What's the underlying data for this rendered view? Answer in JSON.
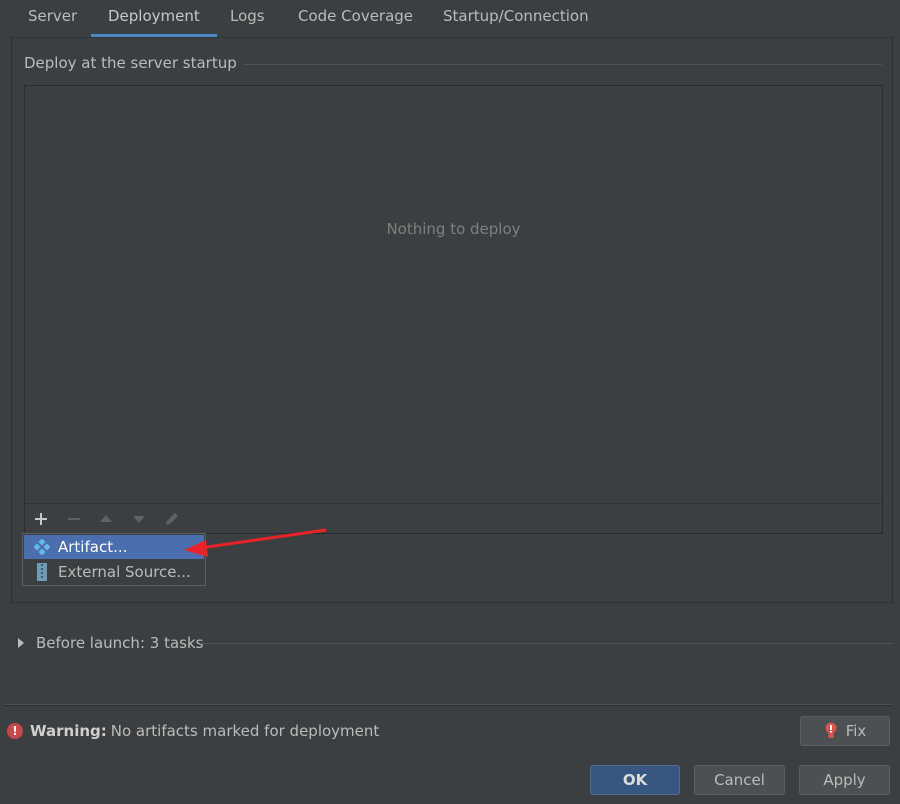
{
  "tabs": [
    {
      "label": "Server"
    },
    {
      "label": "Deployment"
    },
    {
      "label": "Logs"
    },
    {
      "label": "Code Coverage"
    },
    {
      "label": "Startup/Connection"
    }
  ],
  "active_tab": "Deployment",
  "deploy": {
    "section_title": "Deploy at the server startup",
    "empty_text": "Nothing to deploy",
    "toolbar": [
      {
        "icon": "plus-icon",
        "enabled": true
      },
      {
        "icon": "minus-icon",
        "enabled": false
      },
      {
        "icon": "arrow-up-icon",
        "enabled": false
      },
      {
        "icon": "arrow-down-icon",
        "enabled": false
      },
      {
        "icon": "pencil-icon",
        "enabled": false
      }
    ]
  },
  "popup": {
    "items": [
      {
        "label": "Artifact...",
        "icon": "artifact-icon",
        "selected": true
      },
      {
        "label": "External Source...",
        "icon": "archive-icon",
        "selected": false
      }
    ]
  },
  "before_launch": {
    "label": "Before launch: 3 tasks"
  },
  "warning": {
    "bold": "Warning:",
    "message": "No artifacts marked for deployment"
  },
  "buttons": {
    "fix": "Fix",
    "ok": "OK",
    "cancel": "Cancel",
    "apply": "Apply"
  },
  "colors": {
    "accent": "#4a88c7",
    "selection": "#4b6eaf",
    "warning": "#c64a4a",
    "annotation_arrow": "#e8242a"
  }
}
